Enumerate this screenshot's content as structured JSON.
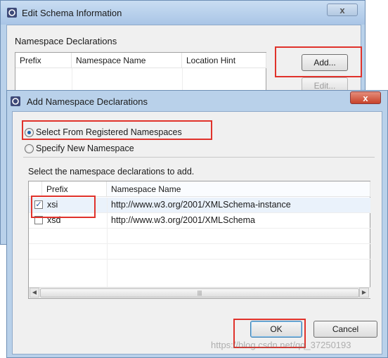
{
  "background_dialog": {
    "title": "Edit Schema Information",
    "section_label": "Namespace Declarations",
    "table_columns": [
      "Prefix",
      "Namespace Name",
      "Location Hint"
    ],
    "add_button": "Add...",
    "edit_button": "Edit...",
    "close_glyph": "x"
  },
  "dialog": {
    "title": "Add Namespace Declarations",
    "close_glyph": "x",
    "radio_registered": "Select From Registered Namespaces",
    "radio_specify": "Specify New Namespace",
    "instruction": "Select the namespace declarations to add.",
    "table_columns": [
      "Prefix",
      "Namespace Name"
    ],
    "rows": [
      {
        "checked": true,
        "prefix": "xsi",
        "namespace": "http://www.w3.org/2001/XMLSchema-instance"
      },
      {
        "checked": false,
        "prefix": "xsd",
        "namespace": "http://www.w3.org/2001/XMLSchema"
      }
    ],
    "ok_button": "OK",
    "cancel_button": "Cancel",
    "check_glyph": "✓",
    "scroll_left_glyph": "◀",
    "scroll_right_glyph": "▶",
    "scroll_thumb_glyph": "|||"
  },
  "watermark": "https://blog.csdn.net/qq_37250193",
  "colors": {
    "highlight_box": "#e0322b",
    "window_frame": "#b9d1ea",
    "dialog_body": "#f0f0f0",
    "radio_dot": "#1c5fa8"
  }
}
